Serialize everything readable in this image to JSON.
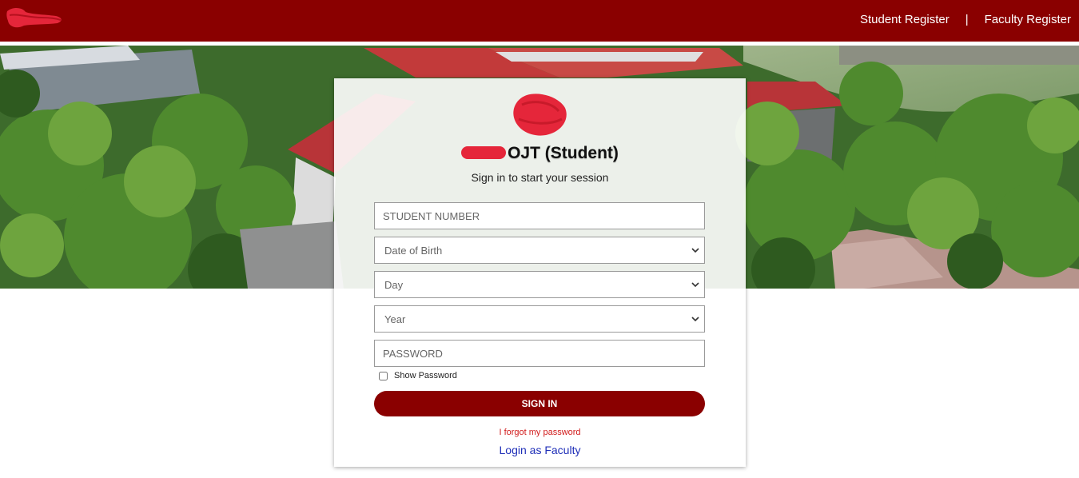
{
  "header": {
    "nav": {
      "student_register": "Student Register",
      "separator": "|",
      "faculty_register": "Faculty Register"
    },
    "colors": {
      "brand": "#8a0000"
    }
  },
  "login": {
    "title": "OJT (Student)",
    "subtitle": "Sign in to start your session",
    "student_number_placeholder": "STUDENT NUMBER",
    "birth_month": {
      "selected": "Date of Birth"
    },
    "birth_day": {
      "selected": "Day"
    },
    "birth_year": {
      "selected": "Year"
    },
    "password_placeholder": "PASSWORD",
    "show_password_label": "Show Password",
    "sign_in_label": "SIGN IN",
    "forgot_password_label": "I forgot my password",
    "faculty_login_label": "Login as Faculty"
  },
  "icons": [
    "logo-mark",
    "card-logo",
    "chevron-down-icon"
  ]
}
